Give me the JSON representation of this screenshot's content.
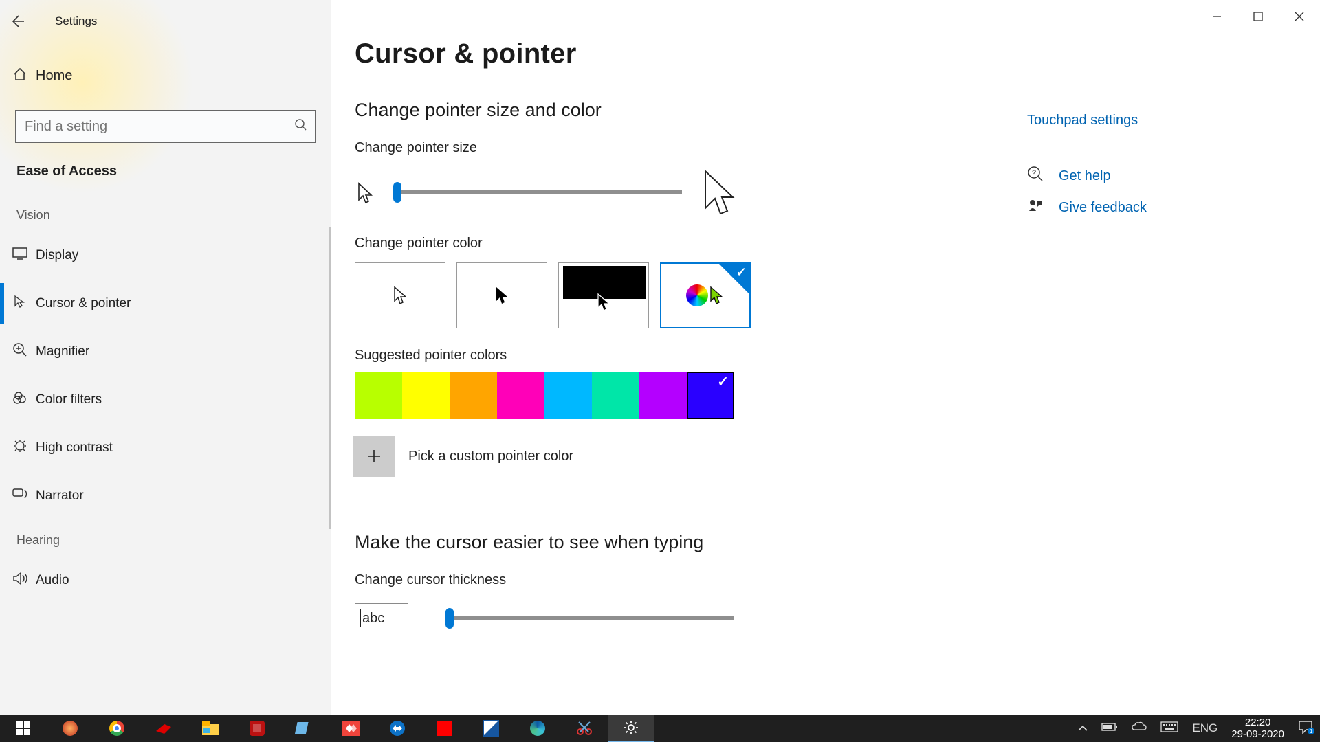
{
  "window": {
    "title": "Settings"
  },
  "sidebar": {
    "home": "Home",
    "search_placeholder": "Find a setting",
    "category": "Ease of Access",
    "section_vision": "Vision",
    "section_hearing": "Hearing",
    "items": [
      {
        "label": "Display"
      },
      {
        "label": "Cursor & pointer"
      },
      {
        "label": "Magnifier"
      },
      {
        "label": "Color filters"
      },
      {
        "label": "High contrast"
      },
      {
        "label": "Narrator"
      },
      {
        "label": "Audio"
      }
    ]
  },
  "page": {
    "title": "Cursor & pointer",
    "h_size_color": "Change pointer size and color",
    "lbl_size": "Change pointer size",
    "lbl_color": "Change pointer color",
    "lbl_suggested": "Suggested pointer colors",
    "lbl_custom": "Pick a custom pointer color",
    "h_thickness": "Make the cursor easier to see when typing",
    "lbl_thickness": "Change cursor thickness",
    "abc": "abc"
  },
  "swatches": [
    "#b8ff00",
    "#ffff00",
    "#ffa500",
    "#ff00b8",
    "#00b8ff",
    "#00e6a8",
    "#b400ff",
    "#2a00ff"
  ],
  "selected_swatch_index": 7,
  "rightcol": {
    "touchpad": "Touchpad settings",
    "help": "Get help",
    "feedback": "Give feedback"
  },
  "taskbar": {
    "lang": "ENG",
    "time": "22:20",
    "date": "29-09-2020"
  }
}
